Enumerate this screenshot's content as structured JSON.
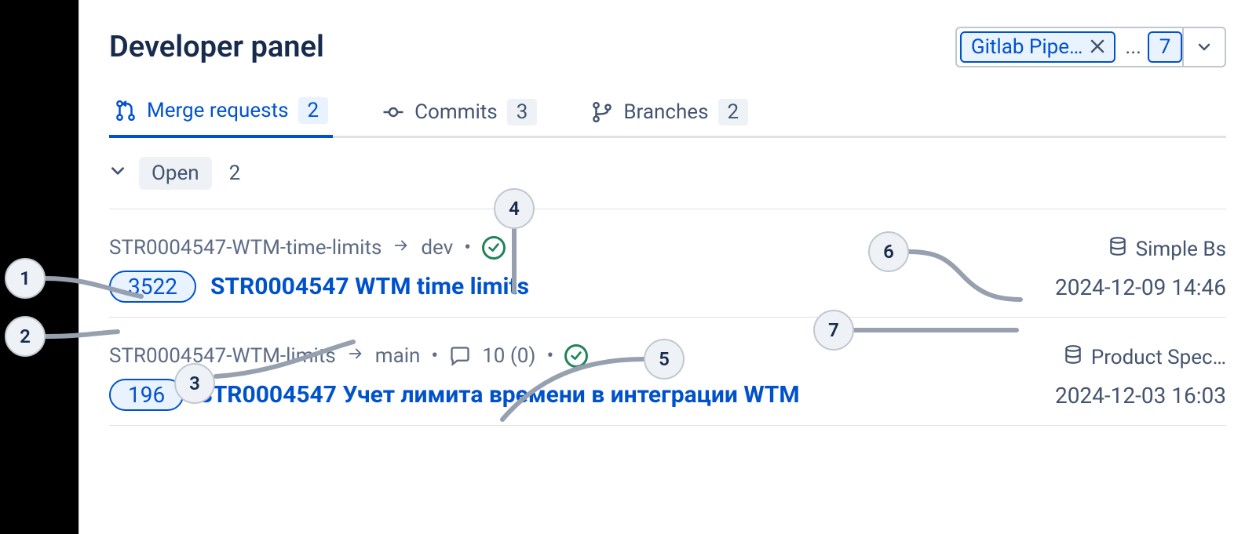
{
  "header": {
    "title": "Developer panel",
    "filter_chip": "Gitlab Pipe…",
    "filter_ellipsis": "...",
    "filter_count": "7"
  },
  "tabs": [
    {
      "key": "mr",
      "label": "Merge requests",
      "count": "2",
      "active": true
    },
    {
      "key": "commits",
      "label": "Commits",
      "count": "3",
      "active": false
    },
    {
      "key": "branches",
      "label": "Branches",
      "count": "2",
      "active": false
    }
  ],
  "section": {
    "label": "Open",
    "count": "2"
  },
  "merge_requests": [
    {
      "source_branch": "STR0004547-WTM-time-limits",
      "target_branch": "dev",
      "status": "ok",
      "comments": "",
      "id": "3522",
      "title": "STR0004547 WTM time limits",
      "repo": "Simple Bs",
      "date": "2024-12-09 14:46"
    },
    {
      "source_branch": "STR0004547-WTM-limits",
      "target_branch": "main",
      "status": "ok",
      "comments": "10 (0)",
      "id": "196",
      "title": "STR0004547 Учет лимита времени в интеграции WTM",
      "repo": "Product Spec…",
      "date": "2024-12-03 16:03"
    }
  ],
  "callouts": {
    "c1": "1",
    "c2": "2",
    "c3": "3",
    "c4": "4",
    "c5": "5",
    "c6": "6",
    "c7": "7"
  }
}
